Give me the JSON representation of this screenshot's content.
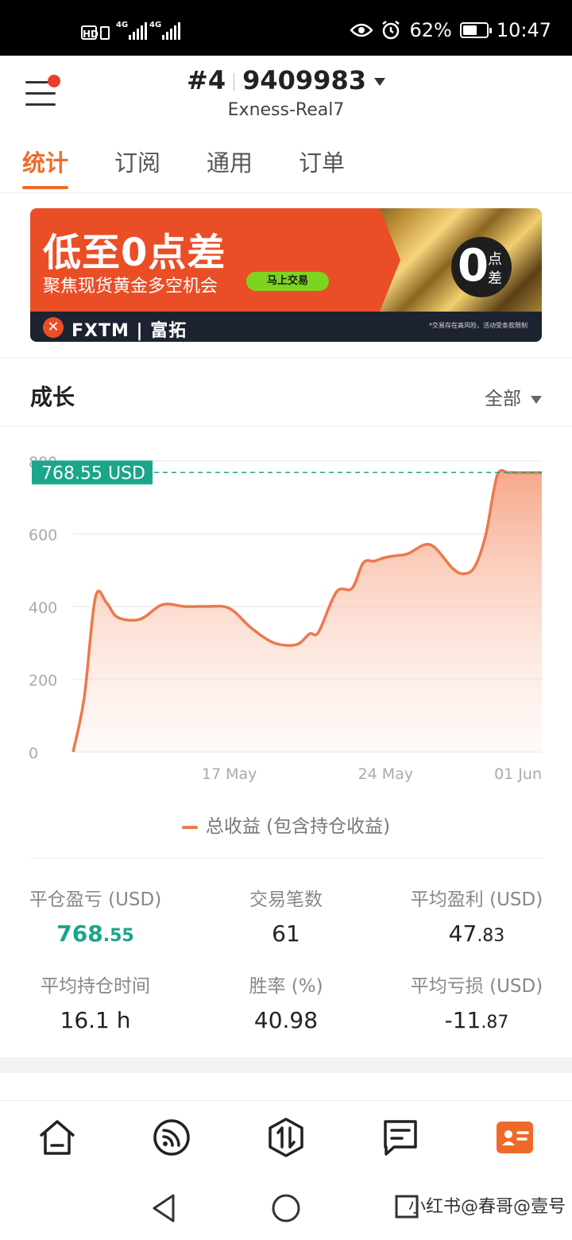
{
  "status_bar": {
    "hd": "HD",
    "net1": "4G",
    "net2": "4G",
    "battery_pct": "62%",
    "battery_level": 0.62,
    "time": "10:47"
  },
  "header": {
    "account_prefix": "#4",
    "account_number": "9409983",
    "server": "Exness-Real7"
  },
  "tabs": [
    {
      "label": "统计",
      "active": true
    },
    {
      "label": "订阅",
      "active": false
    },
    {
      "label": "通用",
      "active": false
    },
    {
      "label": "订单",
      "active": false
    }
  ],
  "banner": {
    "headline": "低至0点差",
    "subline": "聚焦现货黄金多空机会",
    "cta": "马上交易",
    "brand": "FXTM",
    "brand_cn": "富拓",
    "badge_digit": "0",
    "badge_text1": "点",
    "badge_text2": "差",
    "disclaimer": "*交易存在高风险，活动受条款限制"
  },
  "growth": {
    "title": "成长",
    "range": "全部",
    "current_label": "768.55 USD",
    "legend": "总收益 (包含持仓收益)"
  },
  "chart_data": {
    "type": "area",
    "yticks": [
      "0",
      "200",
      "400",
      "600",
      "800"
    ],
    "ylim": [
      0,
      800
    ],
    "xticks": [
      {
        "label": "17 May",
        "x": 7
      },
      {
        "label": "24 May",
        "x": 14
      },
      {
        "label": "01 Jun",
        "x": 21
      }
    ],
    "xlim": [
      0,
      21
    ],
    "x": [
      0,
      0.5,
      1,
      1.5,
      2,
      3,
      4,
      5,
      6,
      7,
      8,
      9,
      10,
      10.6,
      11,
      11.8,
      12.5,
      13,
      13.5,
      14,
      14.5,
      15,
      16,
      17,
      17.5,
      18,
      18.5,
      19,
      19.5,
      20,
      21
    ],
    "values": [
      0,
      150,
      425,
      410,
      370,
      365,
      405,
      400,
      400,
      395,
      340,
      300,
      295,
      325,
      330,
      440,
      450,
      520,
      525,
      535,
      540,
      545,
      570,
      505,
      490,
      510,
      600,
      760,
      768,
      768,
      768
    ],
    "reference_value": 768.55,
    "series_name": "总收益 (包含持仓收益)",
    "line_color": "#ea7a4c",
    "ref_color": "#1aa68a"
  },
  "stats": [
    {
      "label": "平仓盈亏 (USD)",
      "int": "768",
      "dec": ".55",
      "highlight": true
    },
    {
      "label": "交易笔数",
      "int": "61",
      "dec": "",
      "highlight": false
    },
    {
      "label": "平均盈利 (USD)",
      "int": "47",
      "dec": ".83",
      "highlight": false
    },
    {
      "label": "平均持仓时间",
      "int": "16.1 h",
      "dec": "",
      "highlight": false
    },
    {
      "label": "胜率 (%)",
      "int": "40.98",
      "dec": "",
      "highlight": false
    },
    {
      "label": "平均亏损 (USD)",
      "int": "-11",
      "dec": ".87",
      "highlight": false
    }
  ],
  "bottom_nav": [
    {
      "icon": "home-icon"
    },
    {
      "icon": "signal-icon"
    },
    {
      "icon": "trade-icon"
    },
    {
      "icon": "news-icon"
    },
    {
      "icon": "profile-icon",
      "active": true
    }
  ],
  "watermark": "小红书@春哥@壹号",
  "colors": {
    "accent": "#ef6a2a",
    "green": "#1aa68a"
  }
}
